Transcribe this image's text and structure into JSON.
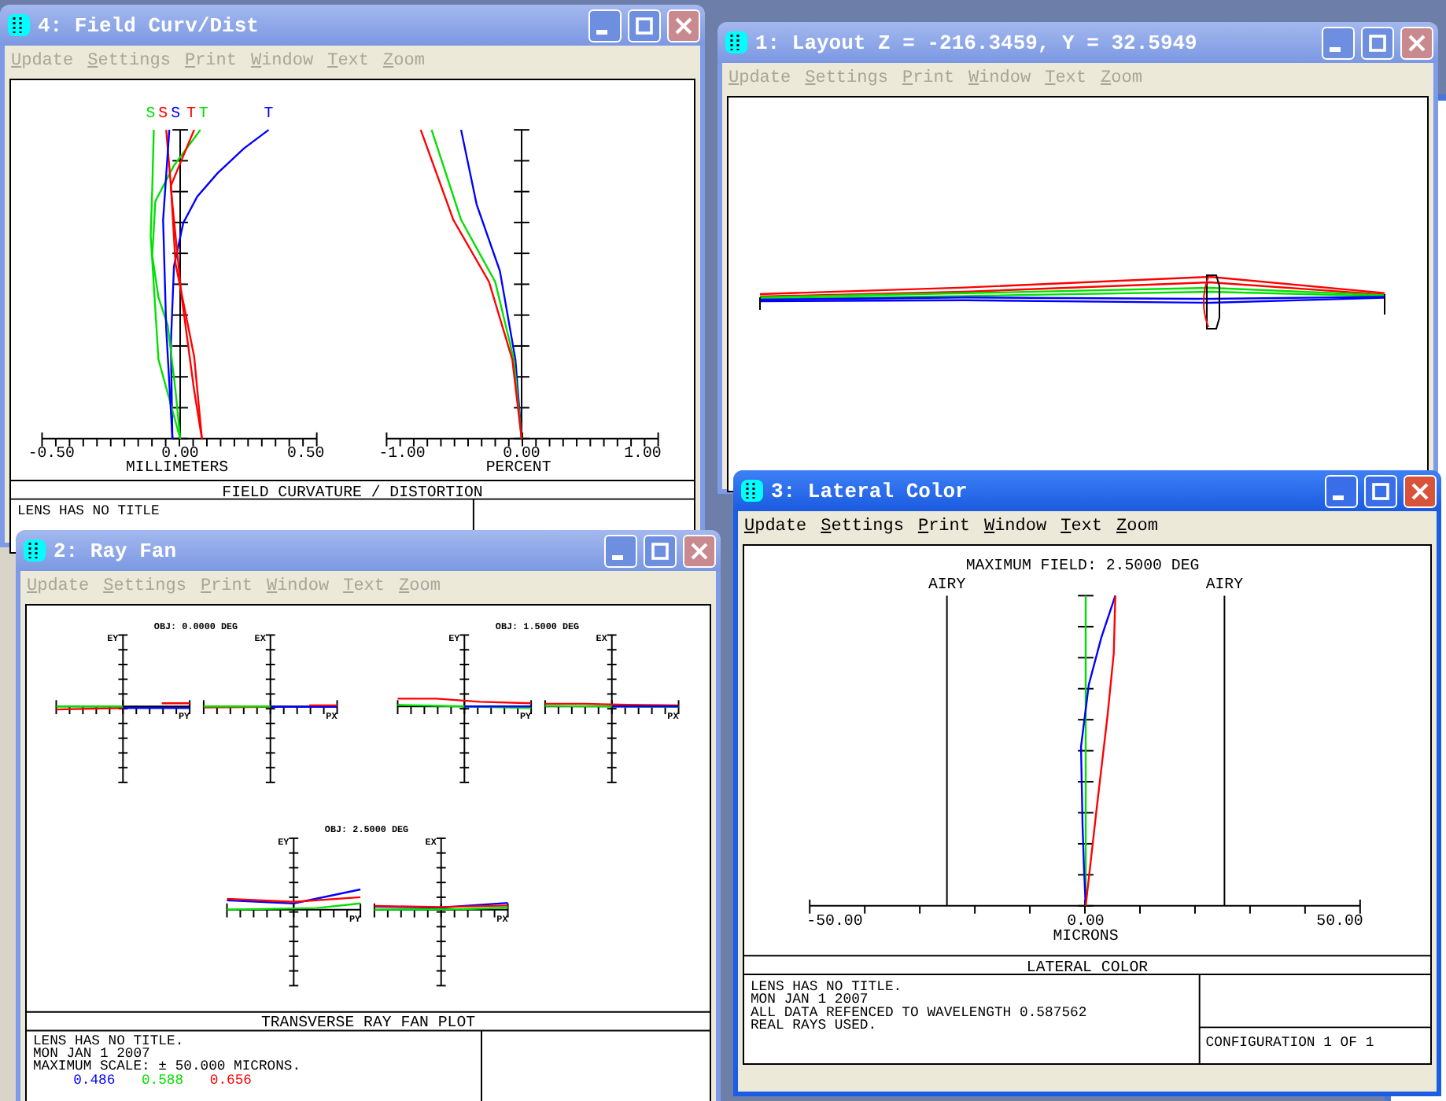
{
  "desktop": {
    "windows": [
      {
        "kind": "field_curvature",
        "title": "4: Field Curv/Dist",
        "active": false,
        "menu": [
          "Update",
          "Settings",
          "Print",
          "Window",
          "Text",
          "Zoom"
        ],
        "field_labels": [
          {
            "label": "S",
            "color": "#00e000"
          },
          {
            "label": "S",
            "color": "#ff0000"
          },
          {
            "label": "S",
            "color": "#0000ff"
          },
          {
            "label": "T",
            "color": "#ff0000"
          },
          {
            "label": "T",
            "color": "#00e000"
          },
          {
            "label": "T",
            "color": "#0000ff"
          }
        ],
        "left_axis": {
          "ticks": [
            "-0.50",
            "0.00",
            "0.50"
          ],
          "label": "MILLIMETERS"
        },
        "right_axis": {
          "ticks": [
            "-1.00",
            "0.00",
            "1.00"
          ],
          "label": "PERCENT"
        },
        "caption": "FIELD CURVATURE / DISTORTION",
        "notes": [
          "LENS HAS NO TITLE"
        ]
      },
      {
        "kind": "layout",
        "title": "1: Layout Z = -216.3459, Y = 32.5949",
        "active": false,
        "menu": [
          "Update",
          "Settings",
          "Print",
          "Window",
          "Text",
          "Zoom"
        ]
      },
      {
        "kind": "ray_fan",
        "title": "2: Ray Fan",
        "active": false,
        "menu": [
          "Update",
          "Settings",
          "Print",
          "Window",
          "Text",
          "Zoom"
        ],
        "plots": [
          {
            "title": "OBJ: 0.0000 DEG",
            "labels": [
              "EY",
              "PY",
              "EX",
              "PX"
            ]
          },
          {
            "title": "OBJ: 1.5000 DEG",
            "labels": [
              "EY",
              "PY",
              "EX",
              "PX"
            ]
          },
          {
            "title": "OBJ: 2.5000 DEG",
            "labels": [
              "EY",
              "PY",
              "EX",
              "PX"
            ]
          }
        ],
        "caption": "TRANSVERSE RAY FAN PLOT",
        "notes": [
          "LENS HAS NO TITLE.",
          "MON JAN 1 2007",
          "MAXIMUM SCALE: ± 50.000 MICRONS."
        ],
        "wavelengths": [
          {
            "label": "0.486",
            "color": "#0000ff"
          },
          {
            "label": "0.588",
            "color": "#00e000"
          },
          {
            "label": "0.656",
            "color": "#ff0000"
          }
        ]
      },
      {
        "kind": "lateral_color",
        "title": "3: Lateral Color",
        "active": true,
        "menu": [
          "Update",
          "Settings",
          "Print",
          "Window",
          "Text",
          "Zoom"
        ],
        "heading": "MAXIMUM FIELD: 2.5000 DEG",
        "markers": [
          "AIRY",
          "AIRY"
        ],
        "axis": {
          "ticks": [
            "-50.00",
            "0.00",
            "50.00"
          ],
          "label": "MICRONS"
        },
        "caption": "LATERAL COLOR",
        "notes": [
          "LENS HAS NO TITLE.",
          "MON JAN 1 2007",
          "ALL DATA REFENCED TO WAVELENGTH 0.587562",
          "REAL RAYS USED."
        ],
        "configuration": "CONFIGURATION 1 OF 1"
      }
    ]
  }
}
